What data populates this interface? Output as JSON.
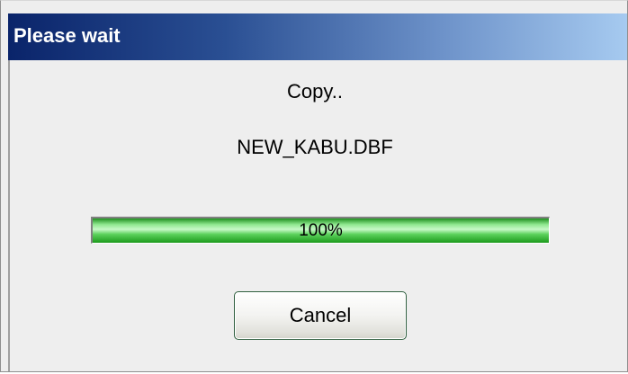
{
  "dialog": {
    "title": "Please wait",
    "status_message": "Copy..",
    "file_name": "NEW_KABU.DBF",
    "progress": {
      "percent": 100,
      "label": "100%"
    },
    "cancel_label": "Cancel"
  },
  "colors": {
    "titlebar_start": "#0a246a",
    "titlebar_end": "#a6caf0",
    "progress_fill": "#3cc03c",
    "dialog_background": "#eeeeee"
  }
}
